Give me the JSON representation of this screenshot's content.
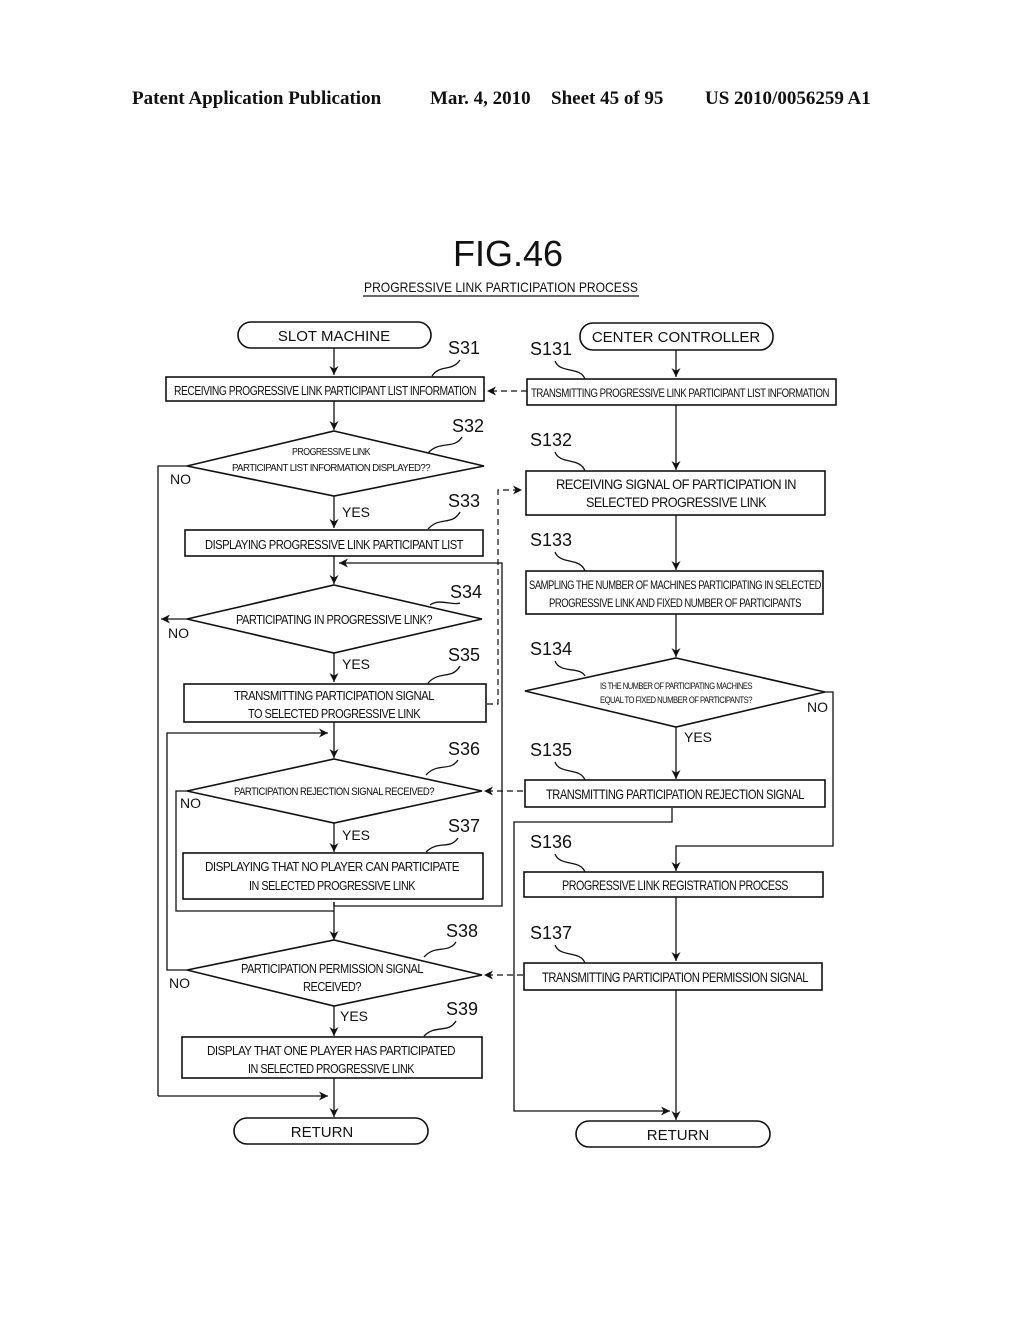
{
  "header": {
    "publication": "Patent Application Publication",
    "date": "Mar. 4, 2010",
    "sheet": "Sheet 45 of 95",
    "number": "US 2010/0056259 A1"
  },
  "figure": {
    "title": "FIG.46",
    "subtitle": "PROGRESSIVE LINK PARTICIPATION PROCESS"
  },
  "slot_machine": {
    "start": "SLOT MACHINE",
    "end": "RETURN",
    "steps": {
      "S31": {
        "id": "S31",
        "lines": [
          "RECEIVING PROGRESSIVE LINK PARTICIPANT LIST INFORMATION"
        ]
      },
      "S32": {
        "id": "S32",
        "lines": [
          "PROGRESSIVE LINK",
          "PARTICIPANT LIST INFORMATION DISPLAYED??"
        ]
      },
      "S33": {
        "id": "S33",
        "lines": [
          "DISPLAYING PROGRESSIVE LINK PARTICIPANT LIST"
        ]
      },
      "S34": {
        "id": "S34",
        "lines": [
          "PARTICIPATING IN PROGRESSIVE LINK?"
        ]
      },
      "S35": {
        "id": "S35",
        "lines": [
          "TRANSMITTING PARTICIPATION SIGNAL",
          "TO SELECTED PROGRESSIVE LINK"
        ]
      },
      "S36": {
        "id": "S36",
        "lines": [
          "PARTICIPATION REJECTION SIGNAL RECEIVED?"
        ]
      },
      "S37": {
        "id": "S37",
        "lines": [
          "DISPLAYING THAT NO PLAYER CAN PARTICIPATE",
          "IN SELECTED PROGRESSIVE LINK"
        ]
      },
      "S38": {
        "id": "S38",
        "lines": [
          "PARTICIPATION PERMISSION SIGNAL",
          "RECEIVED?"
        ]
      },
      "S39": {
        "id": "S39",
        "lines": [
          "DISPLAY THAT ONE PLAYER HAS PARTICIPATED",
          "IN SELECTED PROGRESSIVE LINK"
        ]
      }
    }
  },
  "center_controller": {
    "start": "CENTER CONTROLLER",
    "end": "RETURN",
    "steps": {
      "S131": {
        "id": "S131",
        "lines": [
          "TRANSMITTING PROGRESSIVE LINK PARTICIPANT LIST INFORMATION"
        ]
      },
      "S132": {
        "id": "S132",
        "lines": [
          "RECEIVING SIGNAL OF PARTICIPATION IN",
          "SELECTED PROGRESSIVE LINK"
        ]
      },
      "S133": {
        "id": "S133",
        "lines": [
          "SAMPLING THE NUMBER OF MACHINES PARTICIPATING IN SELECTED",
          "PROGRESSIVE LINK AND FIXED NUMBER OF PARTICIPANTS"
        ]
      },
      "S134": {
        "id": "S134",
        "lines": [
          "IS THE NUMBER OF PARTICIPATING MACHINES",
          "EQUAL TO FIXED NUMBER OF PARTICIPANTS?"
        ]
      },
      "S135": {
        "id": "S135",
        "lines": [
          "TRANSMITTING PARTICIPATION REJECTION SIGNAL"
        ]
      },
      "S136": {
        "id": "S136",
        "lines": [
          "PROGRESSIVE LINK REGISTRATION PROCESS"
        ]
      },
      "S137": {
        "id": "S137",
        "lines": [
          "TRANSMITTING PARTICIPATION PERMISSION SIGNAL"
        ]
      }
    }
  },
  "branch_labels": {
    "yes": "YES",
    "no": "NO"
  }
}
